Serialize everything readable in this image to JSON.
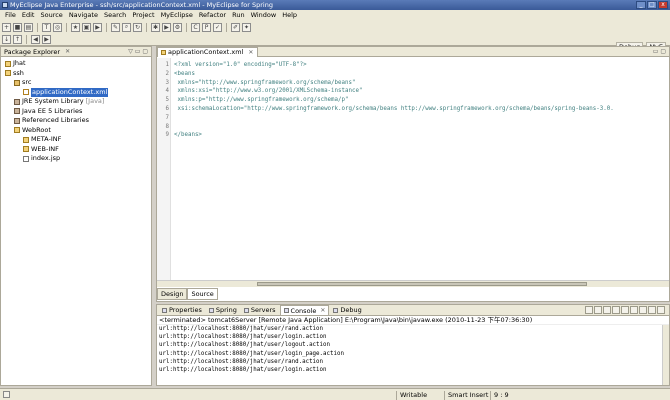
{
  "window": {
    "title": "MyEclipse Java Enterprise - ssh/src/applicationContext.xml - MyEclipse for Spring",
    "minimize": "_",
    "maximize": "□",
    "close": "x"
  },
  "menu": {
    "items": [
      "File",
      "Edit",
      "Source",
      "Navigate",
      "Search",
      "Project",
      "MyEclipse",
      "Refactor",
      "Run",
      "Window",
      "Help"
    ]
  },
  "perspectives": {
    "debug": "Debug",
    "myeclipse": "MyE"
  },
  "package_explorer": {
    "title": "Package Explorer",
    "tree": [
      {
        "label": "Jhat",
        "depth": 1,
        "icon": "project-icon",
        "selected": false,
        "suffix": ""
      },
      {
        "label": "ssh",
        "depth": 1,
        "icon": "project-icon",
        "selected": false,
        "suffix": ""
      },
      {
        "label": "src",
        "depth": 2,
        "icon": "source-folder-icon",
        "selected": false,
        "suffix": ""
      },
      {
        "label": "applicationContext.xml",
        "depth": 3,
        "icon": "xml-file-icon",
        "selected": true,
        "suffix": ""
      },
      {
        "label": "JRE System Library",
        "depth": 2,
        "icon": "library-icon",
        "selected": false,
        "suffix": "[Java]"
      },
      {
        "label": "Java EE 5 Libraries",
        "depth": 2,
        "icon": "library-icon",
        "selected": false,
        "suffix": ""
      },
      {
        "label": "Referenced Libraries",
        "depth": 2,
        "icon": "library-icon",
        "selected": false,
        "suffix": ""
      },
      {
        "label": "WebRoot",
        "depth": 2,
        "icon": "folder-icon",
        "selected": false,
        "suffix": ""
      },
      {
        "label": "META-INF",
        "depth": 3,
        "icon": "folder-icon",
        "selected": false,
        "suffix": ""
      },
      {
        "label": "WEB-INF",
        "depth": 3,
        "icon": "folder-icon",
        "selected": false,
        "suffix": ""
      },
      {
        "label": "index.jsp",
        "depth": 3,
        "icon": "file-icon",
        "selected": false,
        "suffix": ""
      }
    ]
  },
  "editor": {
    "tab": "applicationContext.xml",
    "lines": [
      {
        "num": "1",
        "text": "<?xml version=\"1.0\" encoding=\"UTF-8\"?>"
      },
      {
        "num": "2",
        "text": "<beans"
      },
      {
        "num": "3",
        "text": "    xmlns=\"http://www.springframework.org/schema/beans\""
      },
      {
        "num": "4",
        "text": "    xmlns:xsi=\"http://www.w3.org/2001/XMLSchema-instance\""
      },
      {
        "num": "5",
        "text": "    xmlns:p=\"http://www.springframework.org/schema/p\""
      },
      {
        "num": "6",
        "text": "    xsi:schemaLocation=\"http://www.springframework.org/schema/beans http://www.springframework.org/schema/beans/spring-beans-3.0."
      },
      {
        "num": "7",
        "text": ""
      },
      {
        "num": "8",
        "text": ""
      },
      {
        "num": "9",
        "text": "</beans>"
      }
    ],
    "bottom_tabs": [
      "Design",
      "Source"
    ]
  },
  "console": {
    "tabs": [
      "Properties",
      "Spring",
      "Servers",
      "Console",
      "Debug"
    ],
    "active_tab": "Console",
    "terminated": "<terminated> tomcat6Server [Remote Java Application] E:\\Program\\Java\\bin\\javaw.exe (2010-11-23 下午07:36:30)",
    "lines": [
      "url:http://localhost:8080/jhat/user/rand.action",
      "url:http://localhost:8080/jhat/user/login.action",
      "url:http://localhost:8080/jhat/user/logout.action",
      "url:http://localhost:8080/jhat/user/login_page.action",
      "url:http://localhost:8080/jhat/user/rand.action",
      "url:http://localhost:8080/jhat/user/login.action"
    ]
  },
  "status": {
    "writable": "Writable",
    "insert_mode": "Smart Insert",
    "position": "9 : 9"
  }
}
